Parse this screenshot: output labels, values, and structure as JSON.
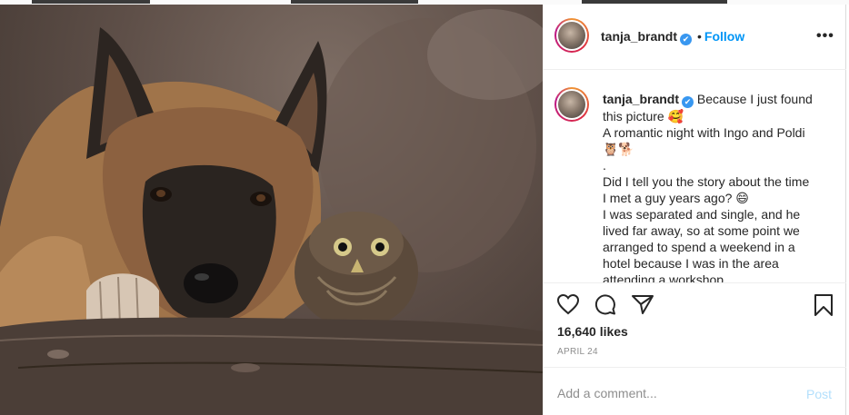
{
  "post": {
    "username": "tanja_brandt",
    "verified_mark": "✔",
    "separator": "•",
    "follow_label": "Follow",
    "more_label": "•••"
  },
  "caption": {
    "username": "tanja_brandt",
    "lines": [
      "Because I just found",
      "this picture 🥰",
      "A romantic night with Ingo and Poldi",
      "🦉🐕",
      ".",
      "Did I tell you the story about the time",
      "I met a guy years ago? 😄",
      "I was separated and single, and he",
      "lived far away, so at some point we",
      "arranged to spend a weekend in a",
      "hotel because I was in the area",
      "attending a workshop"
    ]
  },
  "actions": {
    "like_icon": "heart-icon",
    "comment_icon": "comment-icon",
    "share_icon": "paper-plane-icon",
    "save_icon": "bookmark-icon"
  },
  "likes_text": "16,640 likes",
  "date_text": "APRIL 24",
  "comment_box": {
    "placeholder": "Add a comment...",
    "post_label": "Post"
  },
  "colors": {
    "accent": "#0095f6",
    "verified": "#3897f0",
    "post_disabled": "#b2dffc",
    "muted": "#8e8e8e"
  }
}
